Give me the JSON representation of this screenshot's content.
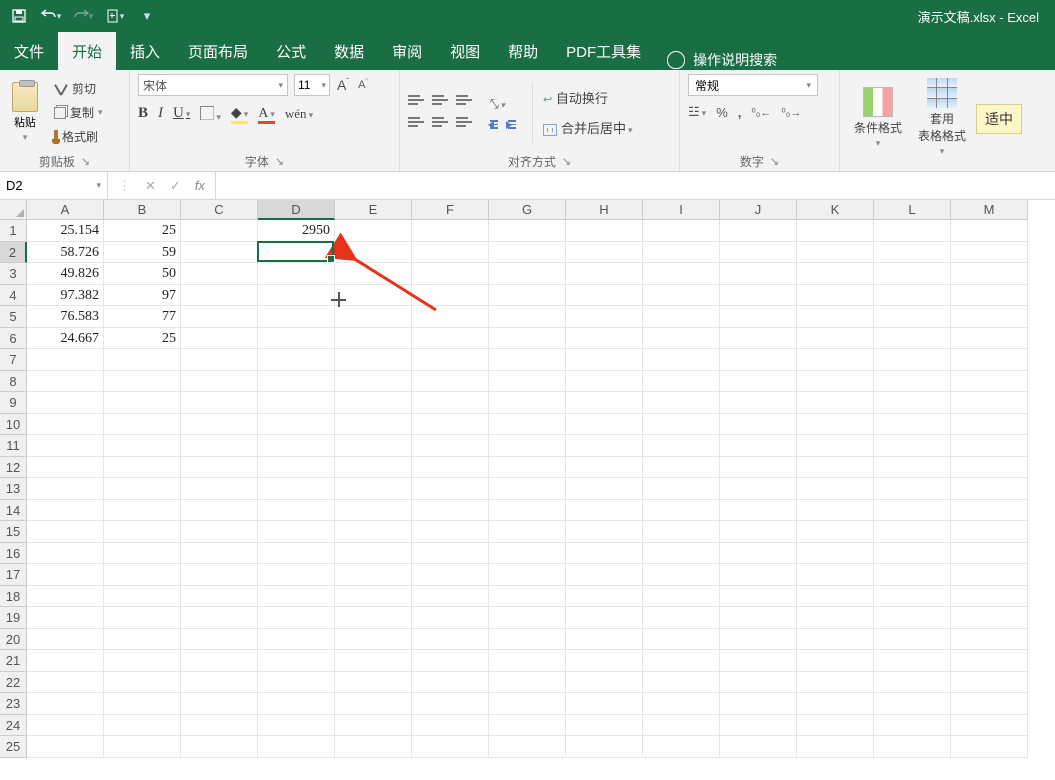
{
  "window": {
    "title": "演示文稿.xlsx - Excel"
  },
  "tabs": {
    "file": "文件",
    "home": "开始",
    "insert": "插入",
    "pagelayout": "页面布局",
    "formulas": "公式",
    "data": "数据",
    "review": "审阅",
    "view": "视图",
    "help": "帮助",
    "pdf": "PDF工具集",
    "search": "操作说明搜索"
  },
  "ribbon": {
    "clipboard": {
      "paste": "粘贴",
      "cut": "剪切",
      "copy": "复制",
      "painter": "格式刷",
      "group": "剪贴板"
    },
    "font": {
      "name": "宋体",
      "size": "11",
      "group": "字体"
    },
    "align": {
      "wrap": "自动换行",
      "merge": "合并后居中",
      "group": "对齐方式"
    },
    "number": {
      "category": "常规",
      "group": "数字"
    },
    "styles": {
      "conditional": "条件格式",
      "use": "套用",
      "tablefmt": "表格格式",
      "cellstyle": "适中"
    }
  },
  "namebox": "D2",
  "formula": "",
  "columns": [
    "A",
    "B",
    "C",
    "D",
    "E",
    "F",
    "G",
    "H",
    "I",
    "J",
    "K",
    "L",
    "M"
  ],
  "rownums": [
    "1",
    "2",
    "3",
    "4",
    "5",
    "6",
    "7",
    "8",
    "9",
    "10",
    "11",
    "12",
    "13",
    "14",
    "15",
    "16",
    "17",
    "18",
    "19",
    "20",
    "21",
    "22",
    "23",
    "24",
    "25"
  ],
  "data": {
    "A1": "25.154",
    "B1": "25",
    "D1": "2950",
    "A2": "58.726",
    "B2": "59",
    "A3": "49.826",
    "B3": "50",
    "A4": "97.382",
    "B4": "97",
    "A5": "76.583",
    "B5": "77",
    "A6": "24.667",
    "B6": "25"
  },
  "selected": {
    "col": "D",
    "row": 2
  }
}
